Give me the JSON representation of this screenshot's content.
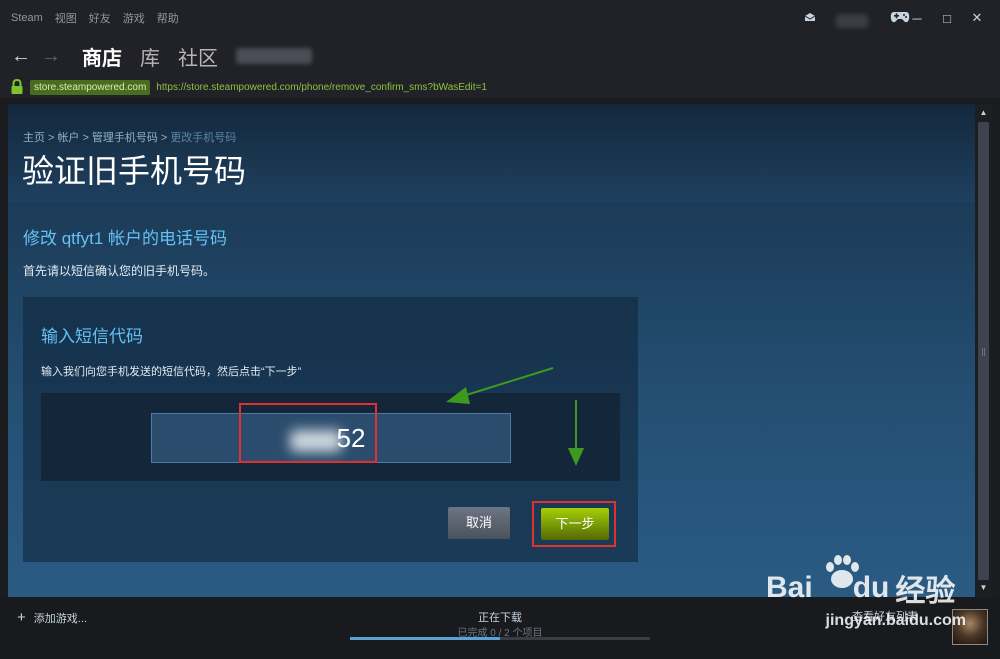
{
  "menubar": {
    "items": [
      "Steam",
      "视图",
      "好友",
      "游戏",
      "帮助"
    ]
  },
  "navbar": {
    "tabs": [
      "商店",
      "库",
      "社区"
    ],
    "active_tab": "商店"
  },
  "urlbar": {
    "domain": "store.steampowered.com",
    "url": "https://store.steampowered.com/phone/remove_confirm_sms?bWasEdit=1"
  },
  "page": {
    "breadcrumb": [
      "主页",
      "帐户",
      "管理手机号码",
      "更改手机号码"
    ],
    "breadcrumb_sep": ">",
    "title": "验证旧手机号码",
    "section_title": "修改 qtfyt1 帐户的电话号码",
    "section_desc": "首先请以短信确认您的旧手机号码。",
    "panel": {
      "title": "输入短信代码",
      "desc": "输入我们向您手机发送的短信代码，然后点击“下一步”",
      "code_value": "52",
      "cancel_label": "取消",
      "next_label": "下一步"
    }
  },
  "bottombar": {
    "add_game": "添加游戏...",
    "download_status": "正在下载",
    "download_sub": "已完成 0 / 2 个项目",
    "download_progress": 0.5,
    "friends_label": "查看好友列表"
  },
  "watermark": {
    "brand_a": "Bai",
    "brand_b": "du",
    "brand_cn": "经验",
    "sub": "jingyan.baidu.com"
  },
  "colors": {
    "accent_blue": "#66c0f4",
    "highlight_red": "#e03131",
    "arrow_green": "#3d9a1e",
    "next_button_green": "#a4d007"
  }
}
